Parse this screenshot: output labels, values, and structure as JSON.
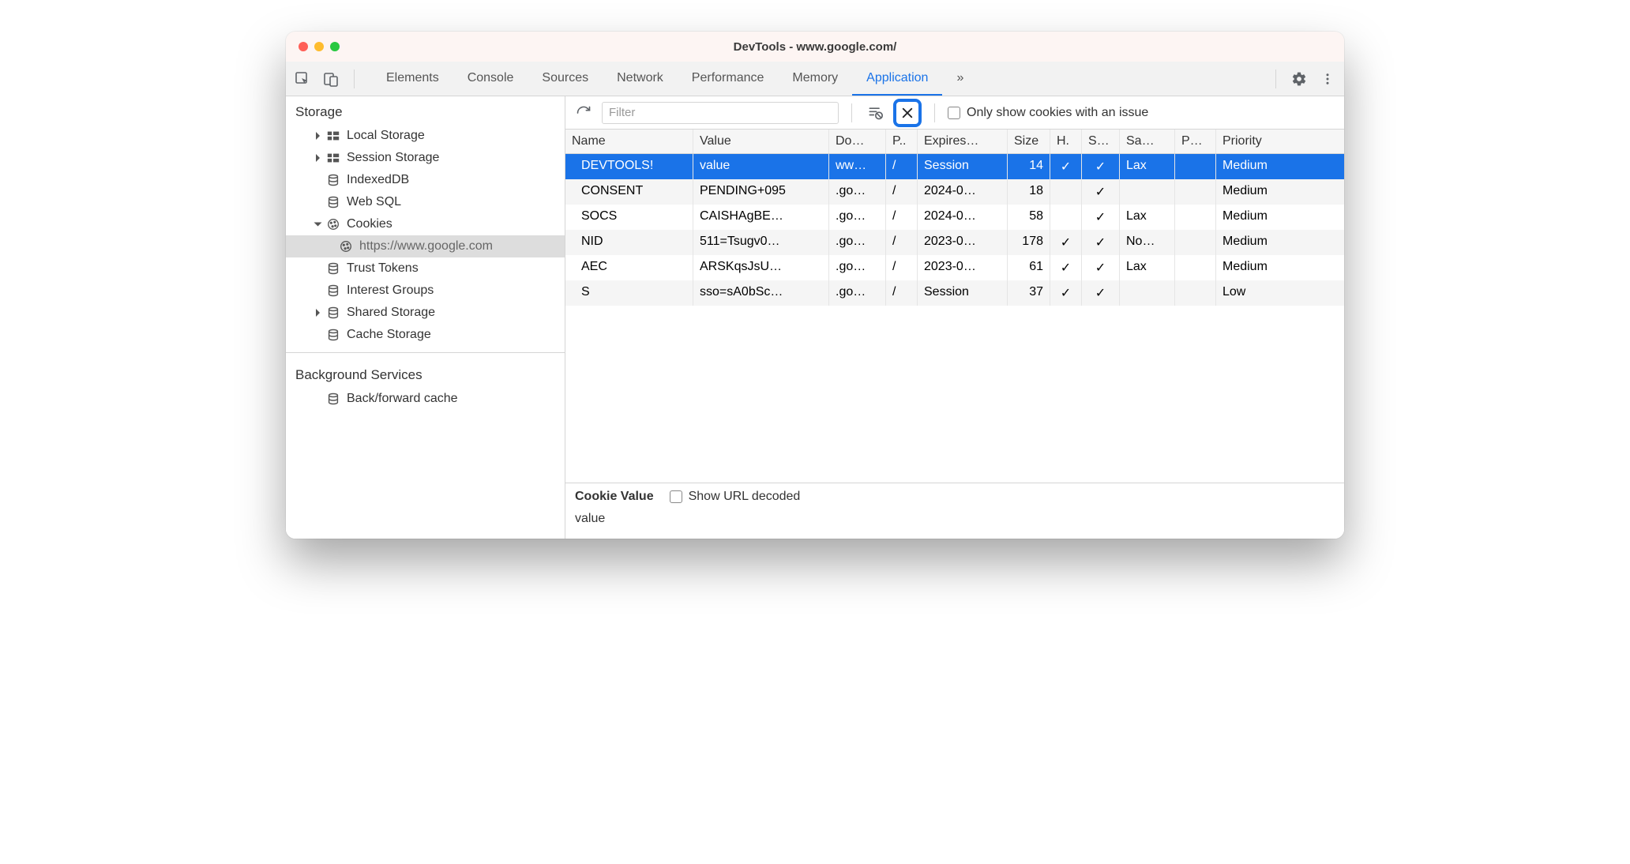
{
  "window": {
    "title": "DevTools - www.google.com/"
  },
  "tabs": {
    "items": [
      "Elements",
      "Console",
      "Sources",
      "Network",
      "Performance",
      "Memory",
      "Application"
    ],
    "active": 6,
    "more": "»"
  },
  "sidebar": {
    "storage_section": "Storage",
    "items": [
      {
        "label": "Local Storage",
        "icon": "grid",
        "expandable": true,
        "expanded": false,
        "level": 1
      },
      {
        "label": "Session Storage",
        "icon": "grid",
        "expandable": true,
        "expanded": false,
        "level": 1
      },
      {
        "label": "IndexedDB",
        "icon": "db",
        "expandable": false,
        "level": 1
      },
      {
        "label": "Web SQL",
        "icon": "db",
        "expandable": false,
        "level": 1
      },
      {
        "label": "Cookies",
        "icon": "cookie",
        "expandable": true,
        "expanded": true,
        "level": 1
      },
      {
        "label": "https://www.google.com",
        "icon": "cookie",
        "expandable": false,
        "level": 2,
        "selected": true
      },
      {
        "label": "Trust Tokens",
        "icon": "db",
        "expandable": false,
        "level": 1
      },
      {
        "label": "Interest Groups",
        "icon": "db",
        "expandable": false,
        "level": 1
      },
      {
        "label": "Shared Storage",
        "icon": "db",
        "expandable": true,
        "expanded": false,
        "level": 1
      },
      {
        "label": "Cache Storage",
        "icon": "db",
        "expandable": false,
        "level": 1
      }
    ],
    "bg_section": "Background Services",
    "bg_items": [
      {
        "label": "Back/forward cache",
        "icon": "db",
        "expandable": false,
        "level": 1
      }
    ]
  },
  "toolbar": {
    "filter_placeholder": "Filter",
    "only_issues_label": "Only show cookies with an issue"
  },
  "table": {
    "headers": [
      "Name",
      "Value",
      "Do…",
      "P..",
      "Expires…",
      "Size",
      "H.",
      "S…",
      "Sa…",
      "P…",
      "Priority"
    ],
    "rows": [
      {
        "name": "DEVTOOLS!",
        "value": "value",
        "domain": "ww…",
        "path": "/",
        "expires": "Session",
        "size": "14",
        "http": "✓",
        "secure": "✓",
        "samesite": "Lax",
        "partition": "",
        "priority": "Medium",
        "selected": true
      },
      {
        "name": "CONSENT",
        "value": "PENDING+095",
        "domain": ".go…",
        "path": "/",
        "expires": "2024-0…",
        "size": "18",
        "http": "",
        "secure": "✓",
        "samesite": "",
        "partition": "",
        "priority": "Medium"
      },
      {
        "name": "SOCS",
        "value": "CAISHAgBE…",
        "domain": ".go…",
        "path": "/",
        "expires": "2024-0…",
        "size": "58",
        "http": "",
        "secure": "✓",
        "samesite": "Lax",
        "partition": "",
        "priority": "Medium"
      },
      {
        "name": "NID",
        "value": "511=Tsugv0…",
        "domain": ".go…",
        "path": "/",
        "expires": "2023-0…",
        "size": "178",
        "http": "✓",
        "secure": "✓",
        "samesite": "No…",
        "partition": "",
        "priority": "Medium"
      },
      {
        "name": "AEC",
        "value": "ARSKqsJsU…",
        "domain": ".go…",
        "path": "/",
        "expires": "2023-0…",
        "size": "61",
        "http": "✓",
        "secure": "✓",
        "samesite": "Lax",
        "partition": "",
        "priority": "Medium"
      },
      {
        "name": "S",
        "value": "sso=sA0bSc…",
        "domain": ".go…",
        "path": "/",
        "expires": "Session",
        "size": "37",
        "http": "✓",
        "secure": "✓",
        "samesite": "",
        "partition": "",
        "priority": "Low"
      }
    ]
  },
  "detail": {
    "label": "Cookie Value",
    "show_decoded": "Show URL decoded",
    "value": "value"
  }
}
